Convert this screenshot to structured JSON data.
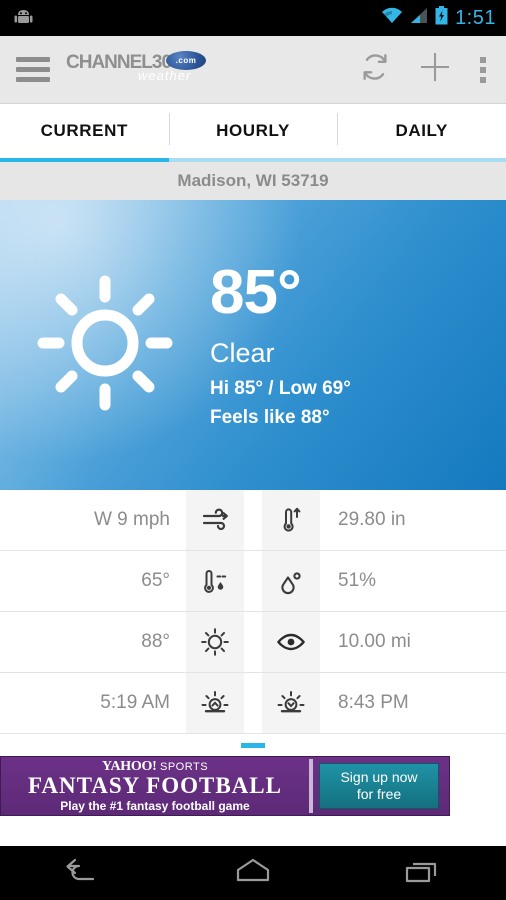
{
  "statusbar": {
    "time": "1:51",
    "icons": [
      "android-robot-icon",
      "wifi-icon",
      "cell-signal-icon",
      "battery-charging-icon"
    ],
    "accent": "#33b5e5"
  },
  "actionbar": {
    "menu_icon": "hamburger-menu-icon",
    "brand_main": "CHANNEL3000",
    "brand_com": ".com",
    "brand_sub": "weather",
    "refresh_icon": "refresh-icon",
    "add_icon": "plus-icon",
    "overflow_icon": "overflow-menu-icon"
  },
  "tabs": [
    {
      "label": "CURRENT",
      "active": true
    },
    {
      "label": "HOURLY",
      "active": false
    },
    {
      "label": "DAILY",
      "active": false
    }
  ],
  "location": {
    "label": "Madison, WI 53719"
  },
  "hero": {
    "icon": "sun-clear-icon",
    "temperature": "85°",
    "condition": "Clear",
    "hi_low": "Hi 85° / Low 69°",
    "feels_like": "Feels like 88°",
    "accent_light": "#8cc2ea",
    "accent_dark": "#1479bf"
  },
  "details": [
    {
      "left_value": "W 9 mph",
      "left_icon": "wind-icon",
      "right_icon": "pressure-thermometer-icon",
      "right_value": "29.80 in"
    },
    {
      "left_value": "65°",
      "left_icon": "dew-point-icon",
      "right_icon": "humidity-droplet-icon",
      "right_value": "51%"
    },
    {
      "left_value": "88°",
      "left_icon": "heat-index-sun-icon",
      "right_icon": "visibility-eye-icon",
      "right_value": "10.00 mi"
    },
    {
      "left_value": "5:19 AM",
      "left_icon": "sunrise-icon",
      "right_icon": "sunset-icon",
      "right_value": "8:43 PM"
    }
  ],
  "pager": {
    "indicator": "page-indicator",
    "accent": "#29b6e8"
  },
  "ad": {
    "brand_prefix": "YAHOO!",
    "brand_suffix": "SPORTS",
    "title": "FANTASY FOOTBALL",
    "subtitle": "Play the #1 fantasy football game",
    "cta_line1": "Sign up now",
    "cta_line2": "for free",
    "bg_color": "#5d2a77",
    "cta_color": "#14707f"
  },
  "navbar": {
    "back": "back-icon",
    "home": "home-icon",
    "recents": "recent-apps-icon"
  }
}
